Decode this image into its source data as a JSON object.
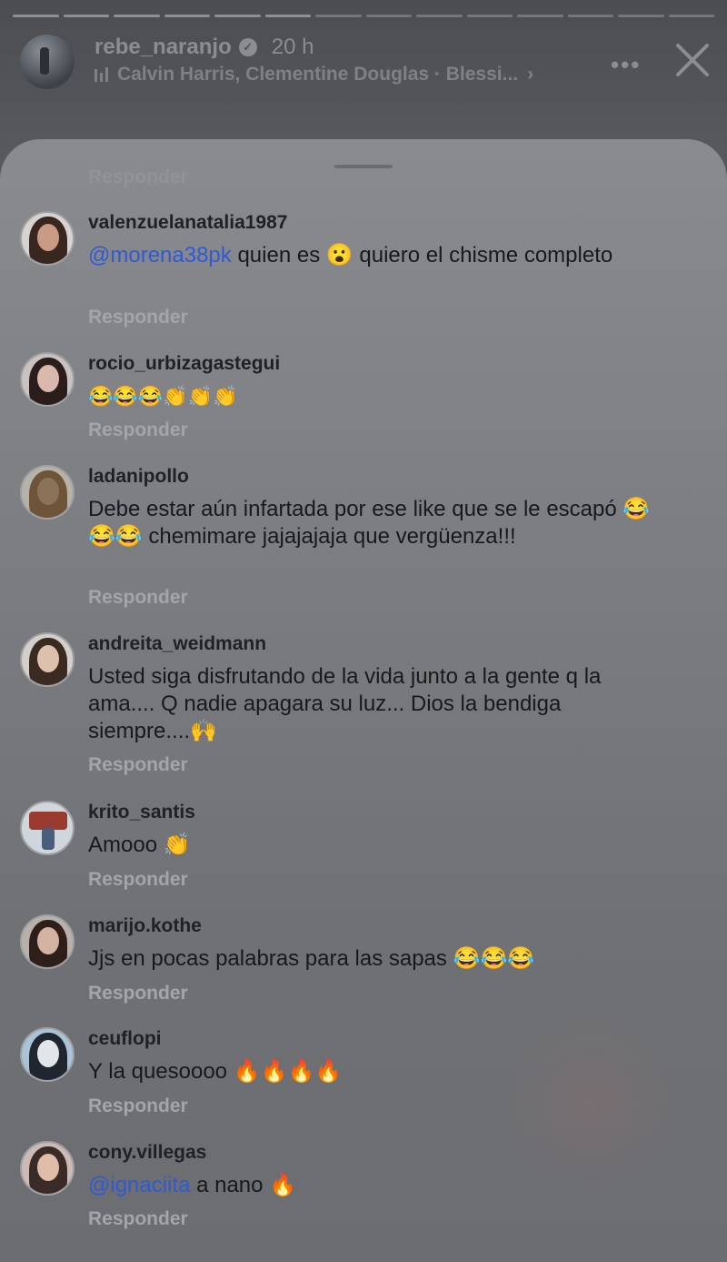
{
  "story": {
    "username": "rebe_naranjo",
    "time": "20 h",
    "music": "Calvin Harris, Clementine Douglas · Blessi...",
    "music_chevron": "›",
    "more_label": "•••",
    "progress_segments": 14,
    "progress_done": 6
  },
  "sheet": {
    "top_reply": "Responder"
  },
  "comments": [
    {
      "username": "valenzuelanatalia1987",
      "mention": "@morena38pk",
      "text": " quien es 😮 quiero el chisme completo",
      "reply": "Responder"
    },
    {
      "username": "rocio_urbizagastegui",
      "mention": "",
      "text": "😂😂😂👏👏👏",
      "reply": "Responder"
    },
    {
      "username": "ladanipollo",
      "mention": "",
      "text": "Debe estar aún infartada por ese like que se le escapó 😂😂😂 chemimare jajajajaja que vergüenza!!!",
      "reply": "Responder"
    },
    {
      "username": "andreita_weidmann",
      "mention": "",
      "text": "Usted siga disfrutando de la vida junto a la gente q la ama.... Q nadie apagara su luz... Dios la bendiga siempre....🙌",
      "reply": "Responder"
    },
    {
      "username": "krito_santis",
      "mention": "",
      "text": "Amooo 👏",
      "reply": "Responder"
    },
    {
      "username": "marijo.kothe",
      "mention": "",
      "text": "Jjs en pocas palabras para las sapas 😂😂😂",
      "reply": "Responder"
    },
    {
      "username": "ceuflopi",
      "mention": "",
      "text": "Y la quesoooo 🔥🔥🔥🔥",
      "reply": "Responder"
    },
    {
      "username": "cony.villegas",
      "mention": "@ignaciita",
      "text": " a nano 🔥",
      "reply": "Responder"
    }
  ]
}
